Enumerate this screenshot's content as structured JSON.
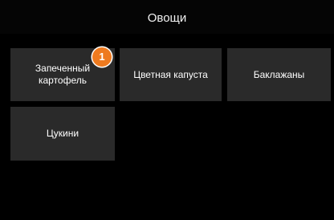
{
  "header": {
    "title": "Овощи"
  },
  "tiles": [
    {
      "label": "Запеченный\nкартофель"
    },
    {
      "label": "Цветная капуста"
    },
    {
      "label": "Баклажаны"
    },
    {
      "label": "Цукини"
    }
  ],
  "badge": {
    "count": "1",
    "color": "#ee7a1f"
  },
  "colors": {
    "background": "#000000",
    "tile": "#2a2a2a",
    "text": "#ffffff"
  }
}
